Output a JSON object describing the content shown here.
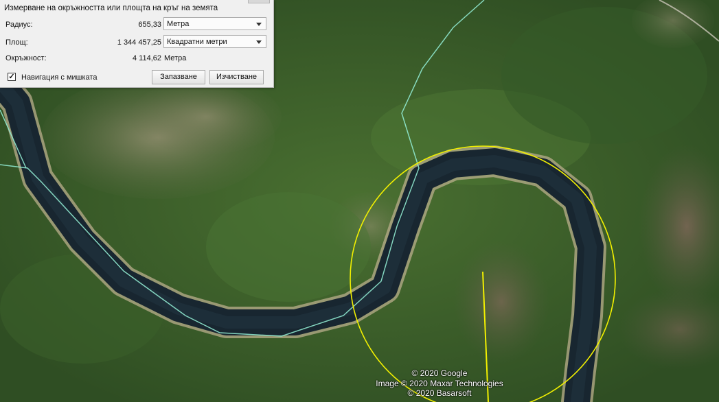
{
  "window": {
    "title": "Измерване на окръжността или площта на кръг на земята"
  },
  "fields": {
    "radius": {
      "label": "Радиус:",
      "value": "655,33",
      "unit": "Метра"
    },
    "area": {
      "label": "Площ:",
      "value": "1 344 457,25",
      "unit": "Квадратни метри"
    },
    "circumference": {
      "label": "Окръжност:",
      "value": "4 114,62",
      "unit": "Метра"
    }
  },
  "mouse_navigation": {
    "label": "Навигация с мишката",
    "checked": true,
    "check_mark": "✓"
  },
  "buttons": {
    "save": "Запазване",
    "clear": "Изчистване"
  },
  "map": {
    "credits": [
      "© 2020 Google",
      "Image © 2020 Maxar Technologies",
      "© 2020 Basarsoft"
    ],
    "colors": {
      "circle": "#f2f000",
      "path": "#8fe8cf",
      "water": "#182630",
      "forest": "#3c6128"
    }
  }
}
